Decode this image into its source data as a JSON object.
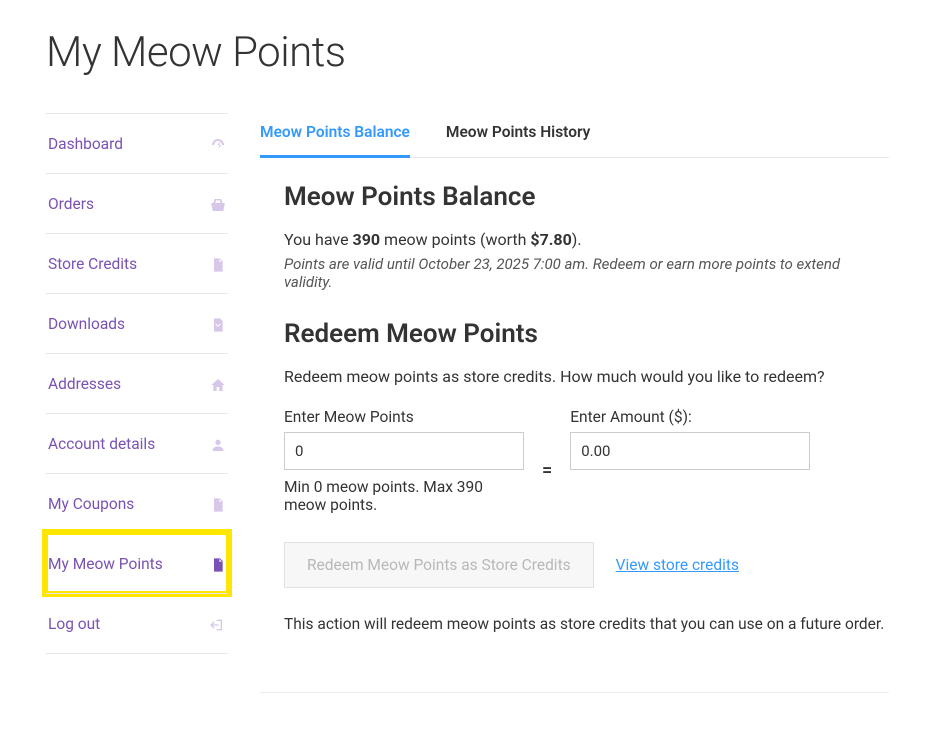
{
  "page_title": "My Meow Points",
  "sidebar": {
    "items": [
      {
        "label": "Dashboard",
        "icon": "dashboard-icon",
        "active": false
      },
      {
        "label": "Orders",
        "icon": "basket-icon",
        "active": false
      },
      {
        "label": "Store Credits",
        "icon": "file-icon",
        "active": false
      },
      {
        "label": "Downloads",
        "icon": "download-icon",
        "active": false
      },
      {
        "label": "Addresses",
        "icon": "home-icon",
        "active": false
      },
      {
        "label": "Account details",
        "icon": "user-icon",
        "active": false
      },
      {
        "label": "My Coupons",
        "icon": "file-icon",
        "active": false
      },
      {
        "label": "My Meow Points",
        "icon": "file-icon",
        "active": true,
        "highlighted": true
      },
      {
        "label": "Log out",
        "icon": "logout-icon",
        "active": false
      }
    ]
  },
  "tabs": [
    {
      "label": "Meow Points Balance",
      "active": true
    },
    {
      "label": "Meow Points History",
      "active": false
    }
  ],
  "balance": {
    "heading": "Meow Points Balance",
    "summary_prefix": "You have ",
    "points": "390",
    "summary_mid": " meow points (worth ",
    "worth": "$7.80",
    "summary_suffix": ").",
    "validity": "Points are valid until October 23, 2025 7:00 am. Redeem or earn more points to extend validity."
  },
  "redeem": {
    "heading": "Redeem Meow Points",
    "description": "Redeem meow points as store credits. How much would you like to redeem?",
    "points_label": "Enter Meow Points",
    "points_value": "0",
    "points_constraints": "Min 0 meow points. Max 390 meow points.",
    "equals": "=",
    "amount_label": "Enter Amount ($):",
    "amount_value": "0.00",
    "button_label": "Redeem Meow Points as Store Credits",
    "view_link": "View store credits",
    "footnote": "This action will redeem meow points as store credits that you can use on a future order."
  }
}
